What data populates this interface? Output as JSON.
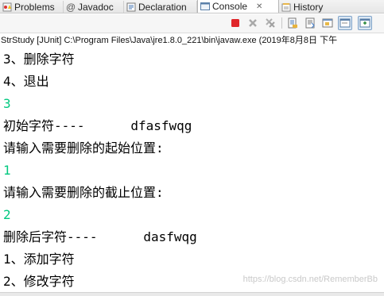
{
  "tabs": [
    {
      "label": "Problems",
      "icon": "problems-icon",
      "active": false
    },
    {
      "label": "Javadoc",
      "icon": "javadoc-icon",
      "active": false
    },
    {
      "label": "Declaration",
      "icon": "declaration-icon",
      "active": false
    },
    {
      "label": "Console",
      "icon": "console-icon",
      "active": true
    },
    {
      "label": "History",
      "icon": "history-icon",
      "active": false
    }
  ],
  "close_symbol": "✕",
  "toolbar": {
    "buttons": [
      "terminate-icon",
      "remove-launch-icon",
      "remove-all-terminated-icon",
      "scroll-lock-icon",
      "word-wrap-icon",
      "pin-console-icon",
      "display-selected-console-icon"
    ]
  },
  "path_line": "StrStudy [JUnit] C:\\Program Files\\Java\\jre1.8.0_221\\bin\\javaw.exe (2019年8月8日 下午",
  "console_lines": [
    {
      "text": "3、删除字符",
      "type": "output"
    },
    {
      "text": "4、退出",
      "type": "output"
    },
    {
      "text": "3",
      "type": "input"
    },
    {
      "text": "初始字符----      dfasfwqg",
      "type": "output"
    },
    {
      "text": "请输入需要删除的起始位置:",
      "type": "output"
    },
    {
      "text": "1",
      "type": "input"
    },
    {
      "text": "请输入需要删除的截止位置:",
      "type": "output"
    },
    {
      "text": "2",
      "type": "input"
    },
    {
      "text": "删除后字符----      dasfwqg",
      "type": "output"
    },
    {
      "text": "1、添加字符",
      "type": "output"
    },
    {
      "text": "2、修改字符",
      "type": "output"
    }
  ],
  "watermark": "https://blog.csdn.net/RememberBb",
  "colors": {
    "input_text": "#00c87f",
    "terminate": "#e0262a"
  }
}
